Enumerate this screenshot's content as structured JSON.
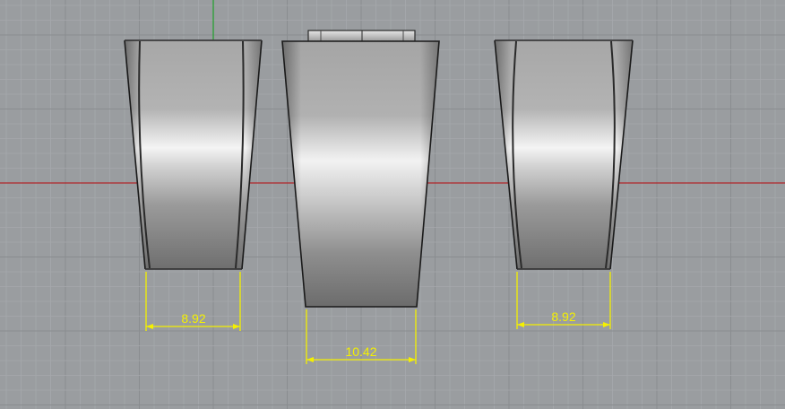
{
  "viewport": {
    "background": "#9a9da0",
    "grid_minor_color": "#a6a9ac",
    "grid_major_color": "#8a8d90",
    "x_axis_color": "#b0262a",
    "y_axis_color": "#1fa12a"
  },
  "dimension_color": "#f4f000",
  "dimensions": {
    "left_ring_width": "8.92",
    "center_ring_width": "10.42",
    "right_ring_width": "8.92"
  }
}
